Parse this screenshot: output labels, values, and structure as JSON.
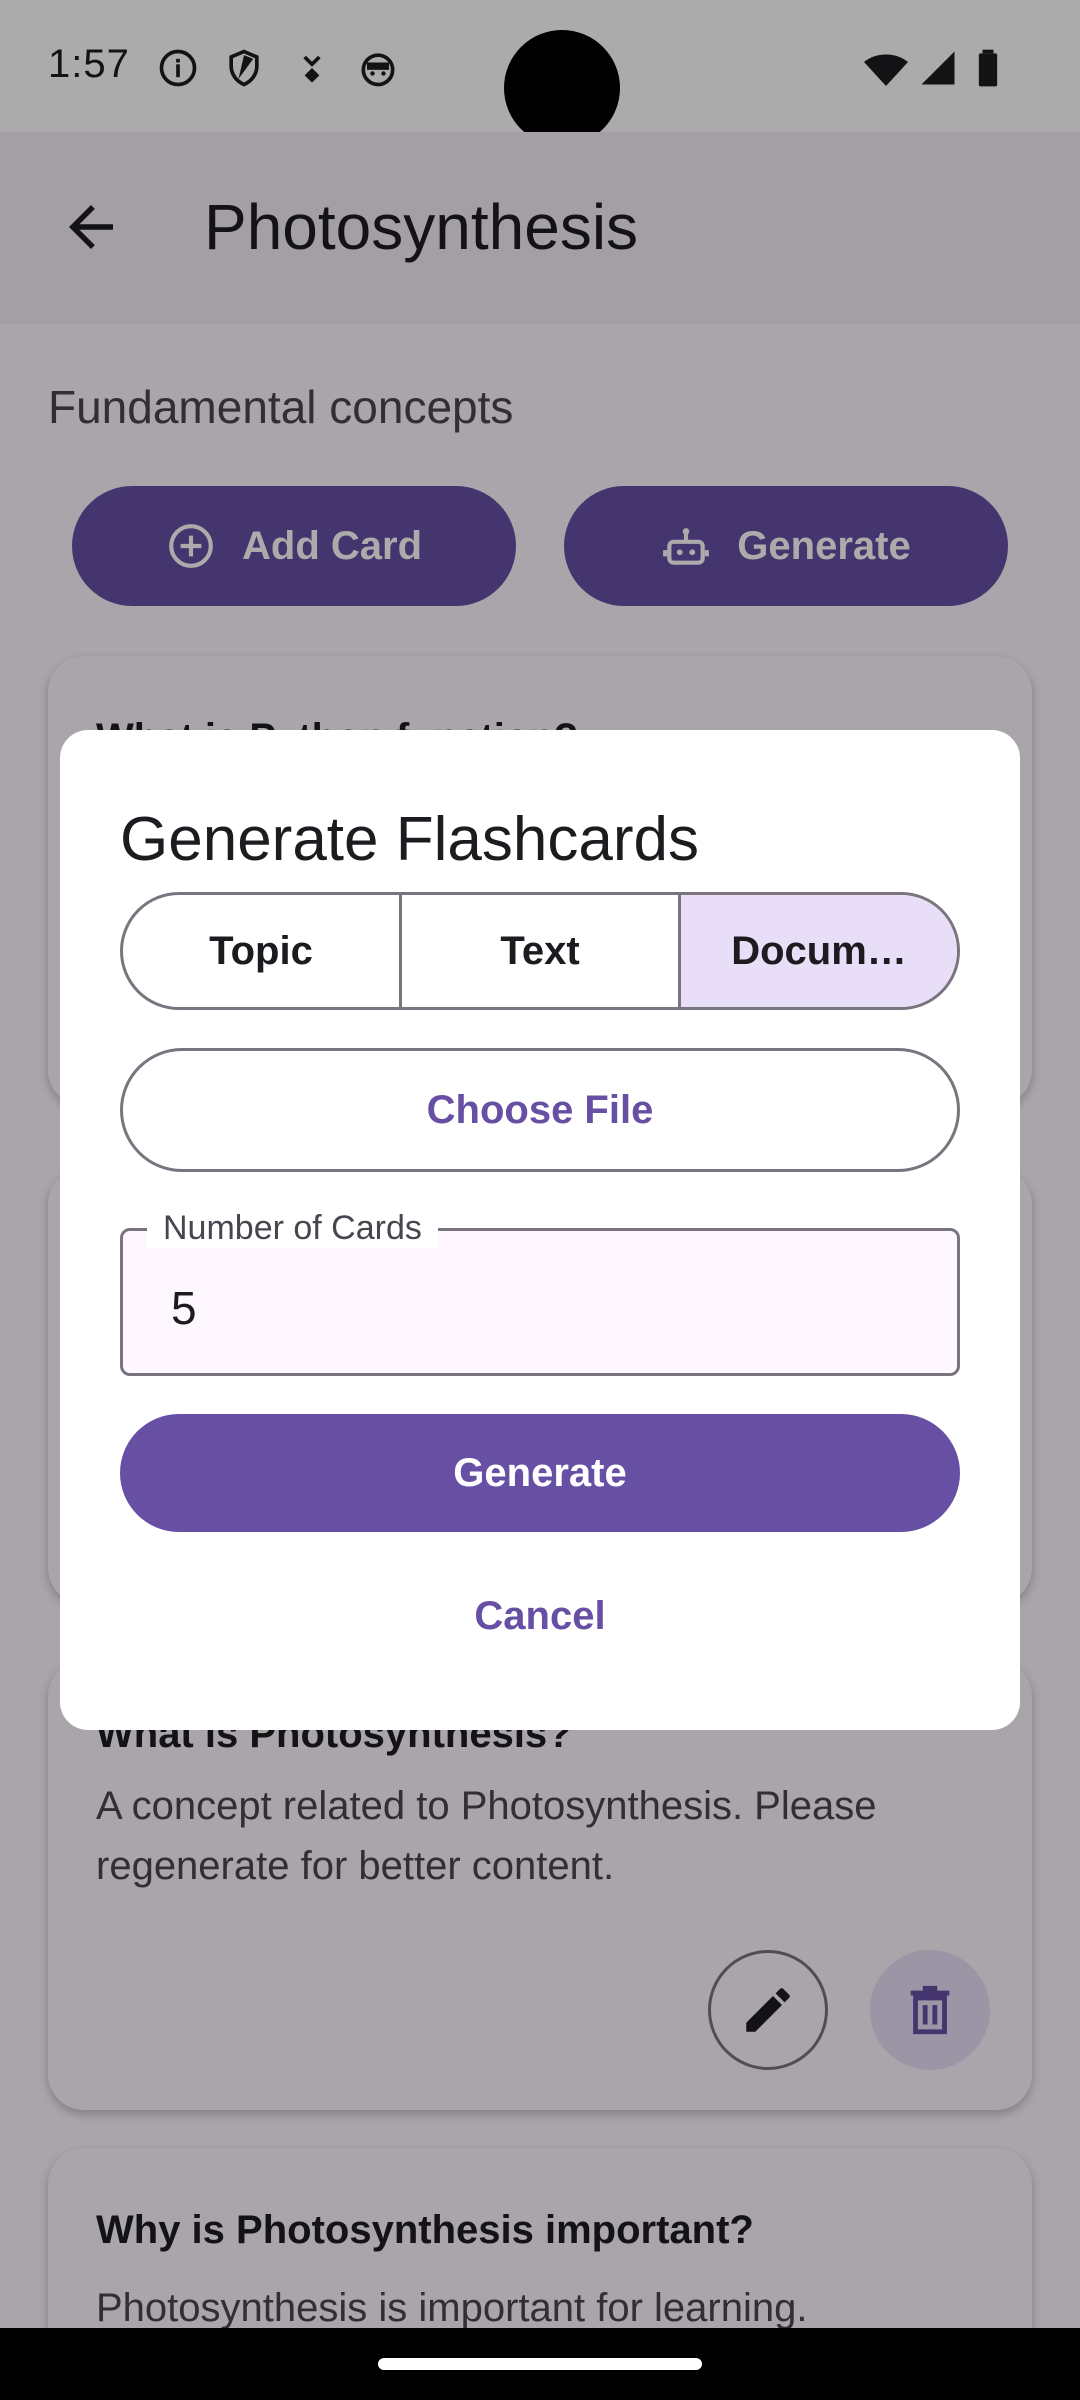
{
  "status_bar": {
    "time": "1:57",
    "icons": [
      "info-icon",
      "shield-icon",
      "download-icon",
      "android-face-icon",
      "wifi-icon",
      "signal-icon",
      "battery-icon"
    ]
  },
  "app_bar": {
    "title": "Photosynthesis",
    "back_icon": "arrow-back-icon"
  },
  "deck": {
    "subtitle": "Fundamental concepts",
    "add_card_label": "Add Card",
    "generate_label": "Generate"
  },
  "cards": [
    {
      "question": "What is Photosynthesis?",
      "answer": "A concept related to Photosynthesis. Please regenerate for better content."
    },
    {
      "question": "Why is Photosynthesis important?",
      "answer": "Photosynthesis is important for learning."
    }
  ],
  "hidden_card_question": "What is Python function?",
  "dialog": {
    "title": "Generate Flashcards",
    "tabs": [
      "Topic",
      "Text",
      "Docum…"
    ],
    "selected_tab": "Docum…",
    "choose_file_label": "Choose File",
    "number_label": "Number of Cards",
    "number_value": "5",
    "generate_label": "Generate",
    "cancel_label": "Cancel"
  },
  "colors": {
    "primary": "#6750a4",
    "secondary_container": "#e8def8",
    "surface": "#fef7ff"
  }
}
